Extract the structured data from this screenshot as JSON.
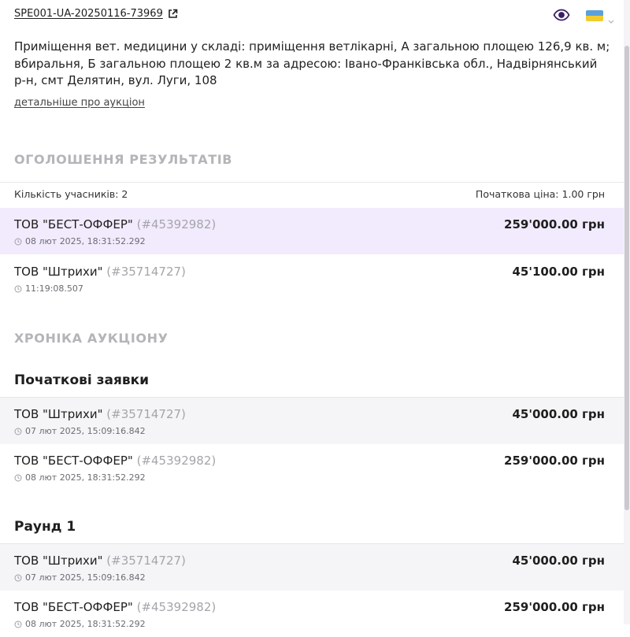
{
  "header": {
    "auction_id": "SPE001-UA-20250116-73969",
    "icons": [
      "external-link-icon",
      "eye-icon",
      "ukraine-flag-icon",
      "chevron-down-icon"
    ]
  },
  "description": "Приміщення вет. медицини у складі: приміщення ветлікарні, А загальною площею 126,9 кв. м; вбиральня, Б загальною площею 2 кв.м за адресою: Івано-Франківська обл., Надвірнянський р-н, смт Делятин, вул. Луги, 108",
  "details_link": "детальніше про аукціон",
  "results": {
    "title": "ОГОЛОШЕННЯ РЕЗУЛЬТАТІВ",
    "participants_label": "Кількість учасників:",
    "participants_value": "2",
    "start_price_label": "Початкова ціна:",
    "start_price_value": "1.00 грн",
    "rows": [
      {
        "name": "ТОВ \"БЕСТ-ОФФЕР\"",
        "code": "(#45392982)",
        "time": "08 лют 2025, 18:31:52.292",
        "amount": "259'000.00 грн"
      },
      {
        "name": "ТОВ \"Штрихи\"",
        "code": "(#35714727)",
        "time": "11:19:08.507",
        "amount": "45'100.00 грн"
      }
    ]
  },
  "chronicle": {
    "title": "ХРОНІКА АУКЦІОНУ",
    "initial_bids": {
      "title": "Початкові заявки",
      "rows": [
        {
          "name": "ТОВ \"Штрихи\"",
          "code": "(#35714727)",
          "time": "07 лют 2025, 15:09:16.842",
          "amount": "45'000.00 грн"
        },
        {
          "name": "ТОВ \"БЕСТ-ОФФЕР\"",
          "code": "(#45392982)",
          "time": "08 лют 2025, 18:31:52.292",
          "amount": "259'000.00 грн"
        }
      ]
    },
    "round1": {
      "title": "Раунд 1",
      "rows": [
        {
          "name": "ТОВ \"Штрихи\"",
          "code": "(#35714727)",
          "time": "07 лют 2025, 15:09:16.842",
          "amount": "45'000.00 грн"
        },
        {
          "name": "ТОВ \"БЕСТ-ОФФЕР\"",
          "code": "(#45392982)",
          "time": "08 лют 2025, 18:31:52.292",
          "amount": "259'000.00 грн"
        }
      ]
    }
  },
  "colors": {
    "accent": "#4b2a7b",
    "highlight_row": "#f2ebfd",
    "muted_title": "#b4b4b9"
  }
}
